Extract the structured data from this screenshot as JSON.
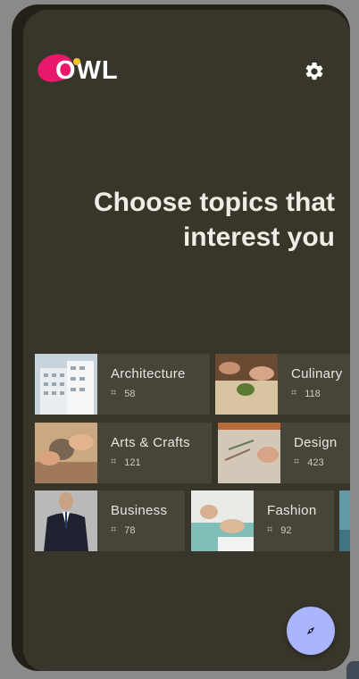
{
  "app": {
    "logo_text": "OWL"
  },
  "headline": {
    "line1": "Choose topics that",
    "line2": "interest you"
  },
  "icons": {
    "settings": "gear-icon",
    "fab": "compass-icon",
    "count": "hashtag-icon"
  },
  "colors": {
    "background": "#38352a",
    "chip": "#47443a",
    "accent": "#e8196a",
    "fab": "#aab4ff"
  },
  "topics": [
    {
      "name": "Architecture",
      "count": "58"
    },
    {
      "name": "Culinary",
      "count": "118"
    },
    {
      "name": "Arts & Crafts",
      "count": "121"
    },
    {
      "name": "Design",
      "count": "423"
    },
    {
      "name": "Business",
      "count": "78"
    },
    {
      "name": "Fashion",
      "count": "92"
    }
  ]
}
